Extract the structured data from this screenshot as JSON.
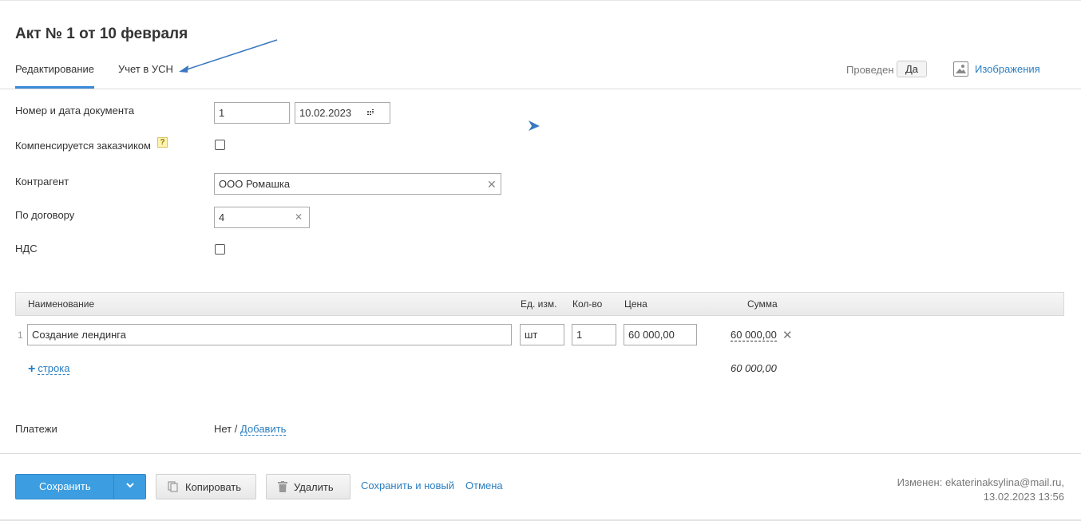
{
  "page": {
    "title": "Акт № 1 от 10 февраля"
  },
  "tabs": [
    {
      "label": "Редактирование",
      "active": true
    },
    {
      "label": "Учет в УСН",
      "active": false
    }
  ],
  "status": {
    "posted_label": "Проведен",
    "posted_value": "Да"
  },
  "images_link": "Изображения",
  "form": {
    "doc_label": "Номер и дата документа",
    "doc_number": "1",
    "doc_date": "10.02.2023",
    "compensated_label": "Компенсируется заказчиком",
    "help_badge": "?",
    "compensated_checked": false,
    "counterparty_label": "Контрагент",
    "counterparty_value": "ООО Ромашка",
    "contract_label": "По договору",
    "contract_value": "4",
    "vat_label": "НДС",
    "vat_checked": false
  },
  "table": {
    "headers": {
      "name": "Наименование",
      "unit": "Ед. изм.",
      "qty": "Кол-во",
      "price": "Цена",
      "sum": "Сумма"
    },
    "rows": [
      {
        "num": "1",
        "name": "Создание лендинга",
        "unit": "шт",
        "qty": "1",
        "price": "60 000,00",
        "sum": "60 000,00"
      }
    ],
    "add_row_plus": "+",
    "add_row_label": "строка",
    "total": "60 000,00"
  },
  "payments": {
    "label": "Платежи",
    "value": "Нет /",
    "add_label": "Добавить"
  },
  "footer": {
    "save_label": "Сохранить",
    "copy_label": "Копировать",
    "delete_label": "Удалить",
    "save_new_label": "Сохранить и новый",
    "cancel_label": "Отмена",
    "modified_line1": "Изменен: ekaterinaksylina@mail.ru,",
    "modified_line2": "13.02.2023 13:56"
  },
  "colors": {
    "accent": "#3c9ee0",
    "link": "#2a7ec1",
    "annotation_arrow": "#3a78c0"
  },
  "icons": [
    "image-icon",
    "calendar-icon",
    "help-icon",
    "clear-icon",
    "chevron-down-icon",
    "copy-icon",
    "trash-icon",
    "annotation-arrow-icon"
  ]
}
